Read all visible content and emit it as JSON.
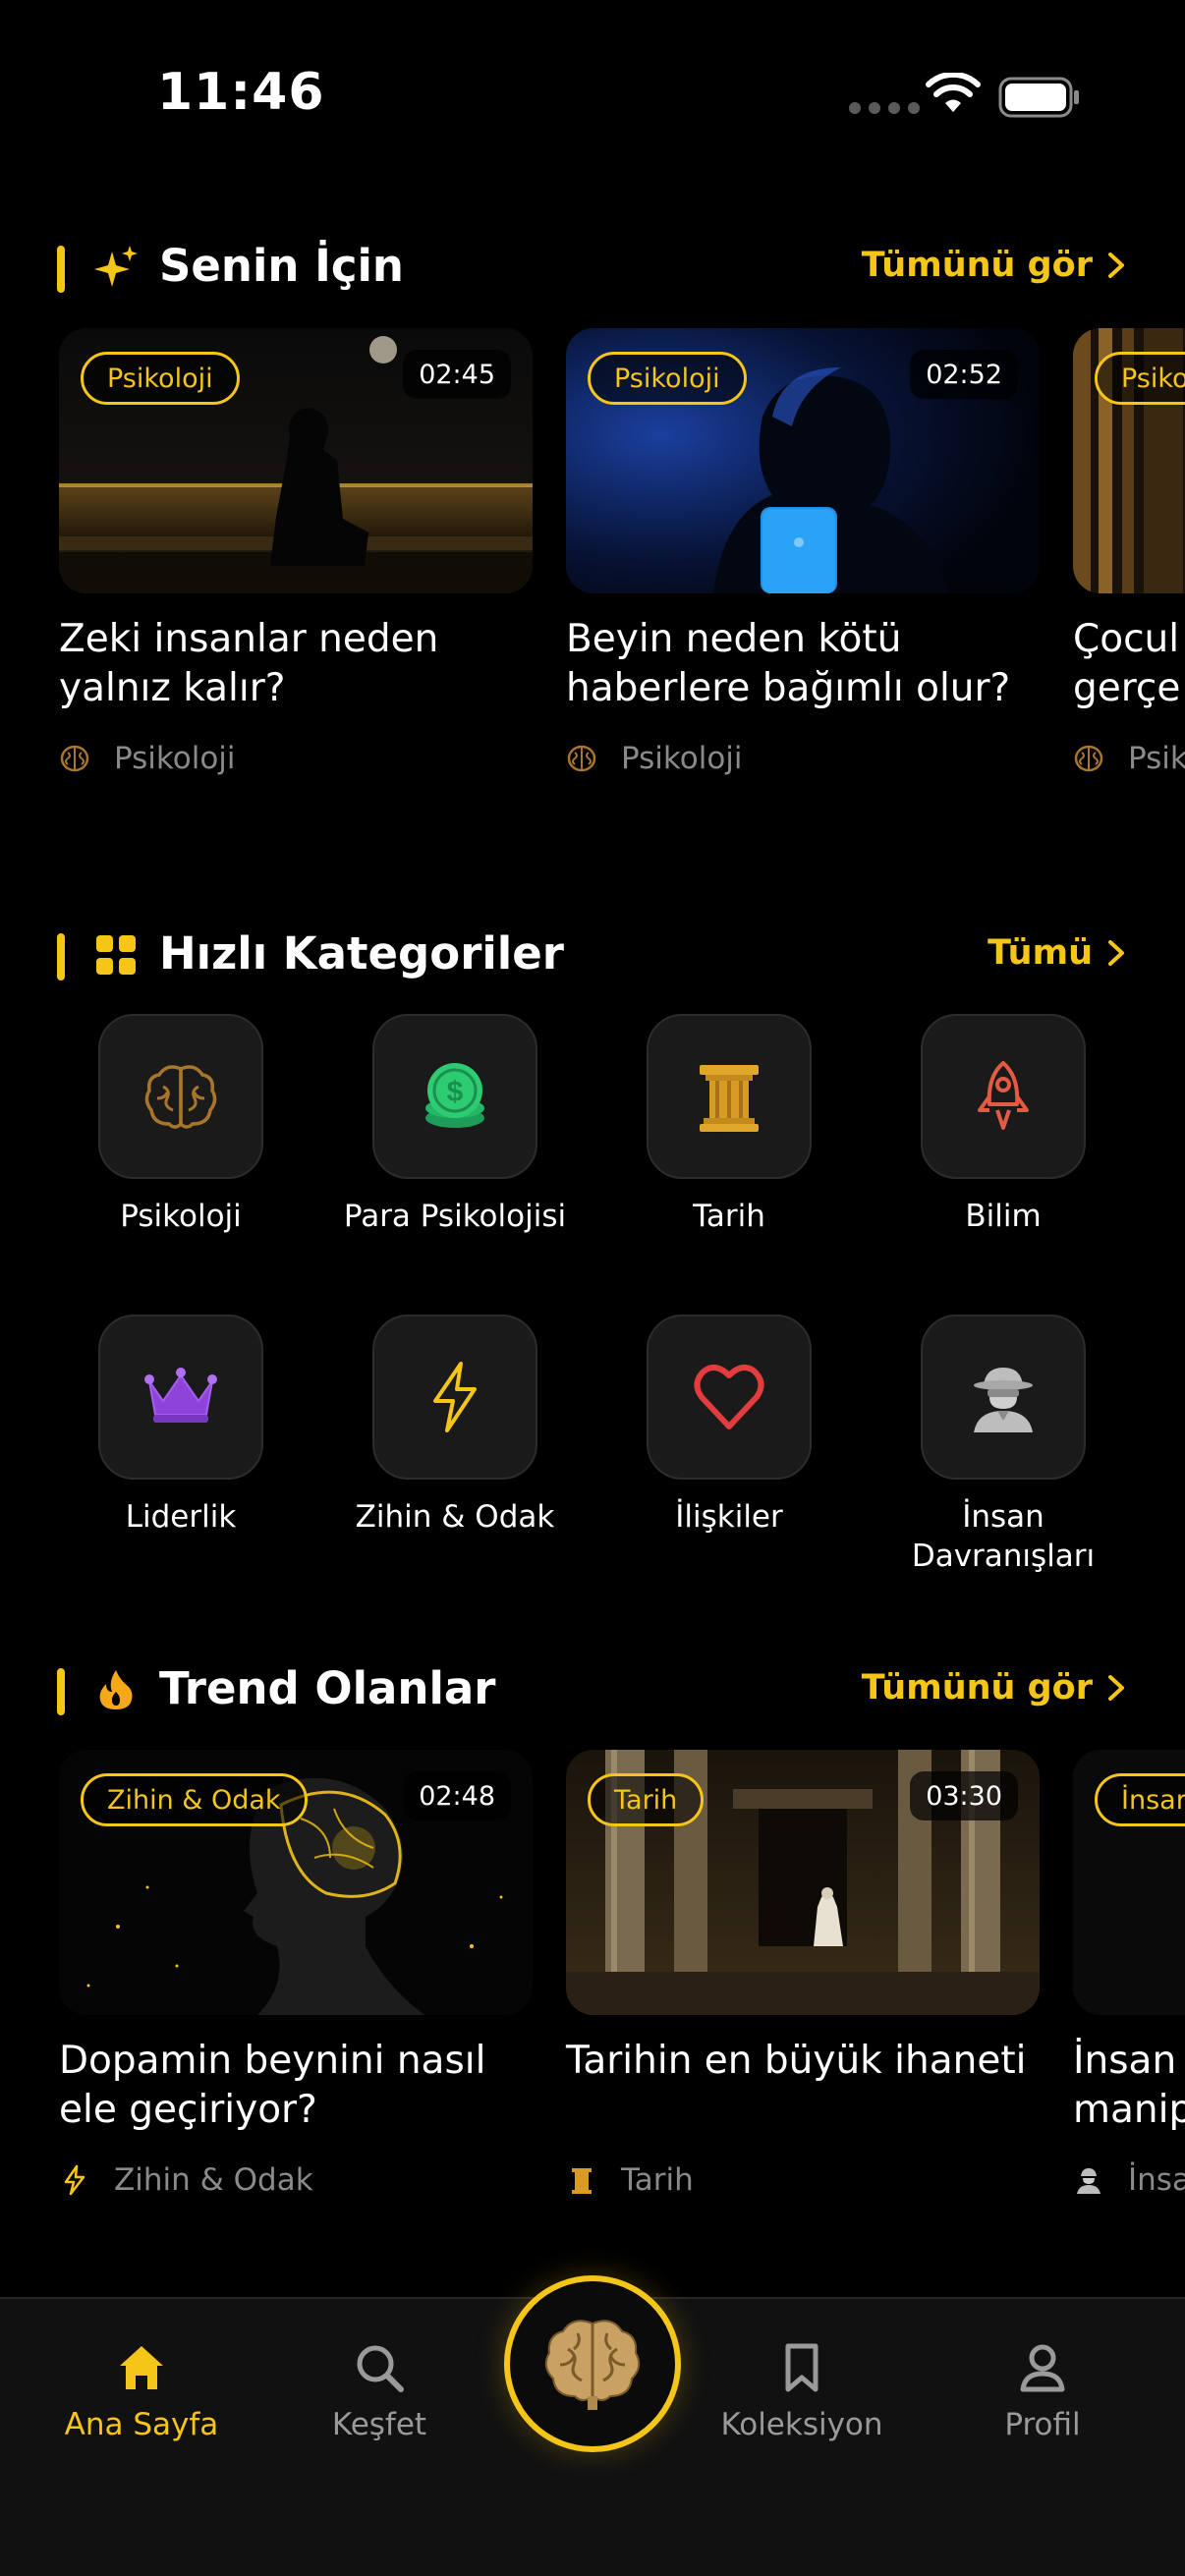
{
  "status_bar": {
    "time": "11:46"
  },
  "for_you": {
    "title": "Senin İçin",
    "link": "Tümünü gör",
    "cards": [
      {
        "tag": "Psikoloji",
        "duration": "02:45",
        "title": "Zeki insanlar neden yalnız kalır?",
        "category": "Psikoloji"
      },
      {
        "tag": "Psikoloji",
        "duration": "02:52",
        "title": "Beyin neden kötü haberlere bağımlı olur?",
        "category": "Psikoloji"
      },
      {
        "tag": "Psiko",
        "title": "Çocul gerçe",
        "category": "Psik"
      }
    ]
  },
  "quick_categories": {
    "title": "Hızlı Kategoriler",
    "link": "Tümü",
    "items": [
      {
        "label": "Psikoloji",
        "icon": "brain-icon"
      },
      {
        "label": "Para Psikolojisi",
        "icon": "coins-icon"
      },
      {
        "label": "Tarih",
        "icon": "column-icon"
      },
      {
        "label": "Bilim",
        "icon": "rocket-icon"
      },
      {
        "label": "Liderlik",
        "icon": "crown-icon"
      },
      {
        "label": "Zihin & Odak",
        "icon": "lightning-icon"
      },
      {
        "label": "İlişkiler",
        "icon": "heart-icon"
      },
      {
        "label": "İnsan Davranışları",
        "icon": "spy-icon"
      }
    ]
  },
  "trending": {
    "title": "Trend Olanlar",
    "link": "Tümünü gör",
    "cards": [
      {
        "tag": "Zihin & Odak",
        "duration": "02:48",
        "title": "Dopamin beynini nasıl ele geçiriyor?",
        "category": "Zihin & Odak"
      },
      {
        "tag": "Tarih",
        "duration": "03:30",
        "title": "Tarihin en büyük ihaneti",
        "category": "Tarih"
      },
      {
        "tag": "İnsar",
        "title": "İnsan manip",
        "category": "İnsa"
      }
    ]
  },
  "bottom_nav": {
    "items": [
      {
        "label": "Ana Sayfa",
        "icon": "home-icon",
        "active": true
      },
      {
        "label": "Keşfet",
        "icon": "search-icon"
      },
      {
        "label": "Koleksiyon",
        "icon": "bookmark-icon"
      },
      {
        "label": "Profil",
        "icon": "profile-icon"
      }
    ],
    "center_icon": "brain-logo-icon"
  },
  "colors": {
    "accent": "#f5c518",
    "background": "#000000",
    "muted": "#8a8a8a"
  }
}
